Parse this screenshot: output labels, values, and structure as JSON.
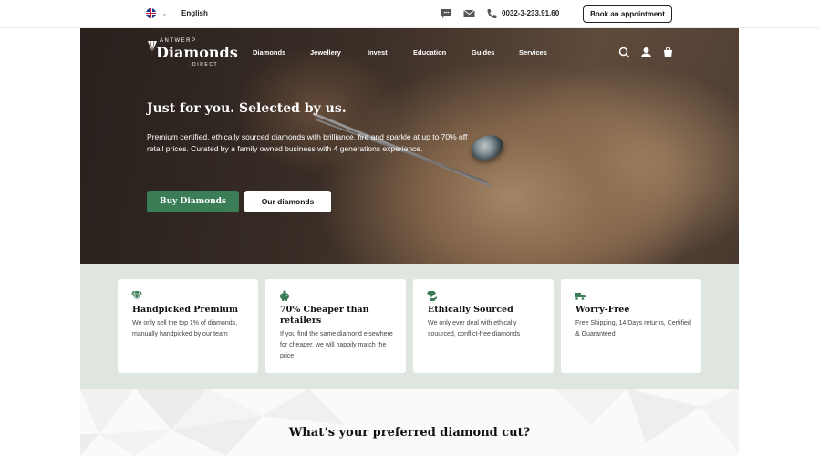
{
  "topbar": {
    "language": "English",
    "flag_icon": "uk-flag-icon",
    "phone": "0032-3-233.91.60",
    "appointment_label": "Book an appointment"
  },
  "logo": {
    "top": "ANTWERP",
    "main": "Diamonds",
    "sub": ".DIRECT"
  },
  "nav": {
    "items": [
      {
        "label": "Diamonds"
      },
      {
        "label": "Jewellery"
      },
      {
        "label": "Invest"
      },
      {
        "label": "Education"
      },
      {
        "label": "Guides"
      },
      {
        "label": "Services"
      }
    ]
  },
  "hero": {
    "title": "Just for you. Selected by us.",
    "text": "Premium certified, ethically sourced diamonds with brilliance, fire and sparkle at up to 70% off retail prices. Curated by a family owned business with 4 generations experience.",
    "buy_label": "Buy Diamonds",
    "our_label": "Our diamonds"
  },
  "features": [
    {
      "title": "Handpicked Premium",
      "text": "We only sell the top 1% of diamonds, manually handpicked by our team",
      "icon": "diamond-icon"
    },
    {
      "title": "70% Cheaper than retailers",
      "text": "If you find the same diamond elsewhere for cheaper, we will happily match the price",
      "icon": "piggy-bank-icon"
    },
    {
      "title": "Ethically Sourced",
      "text": "We only ever deal with ethically souurced, conflict-free diamonds",
      "icon": "hand-diamond-icon"
    },
    {
      "title": "Worry-Free",
      "text": "Free Shipping, 14 Days returns, Certified & Guaranteed",
      "icon": "truck-icon"
    }
  ],
  "cut_section": {
    "title": "What’s your preferred diamond cut?"
  },
  "colors": {
    "accent_green": "#3a7d56",
    "features_bg": "#dfe6e0"
  }
}
